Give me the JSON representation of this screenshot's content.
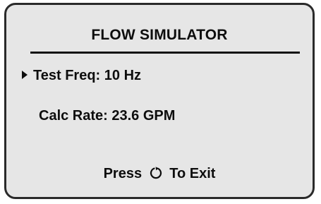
{
  "screen": {
    "title": "FLOW SIMULATOR",
    "rows": [
      {
        "label": "Test Freq:",
        "value": "10 Hz",
        "selected": true
      },
      {
        "label": "Calc Rate:",
        "value": "23.6 GPM",
        "selected": false
      }
    ],
    "footer": {
      "prefix": "Press",
      "icon": "rotate-clockwise-icon",
      "suffix": "To Exit"
    }
  }
}
